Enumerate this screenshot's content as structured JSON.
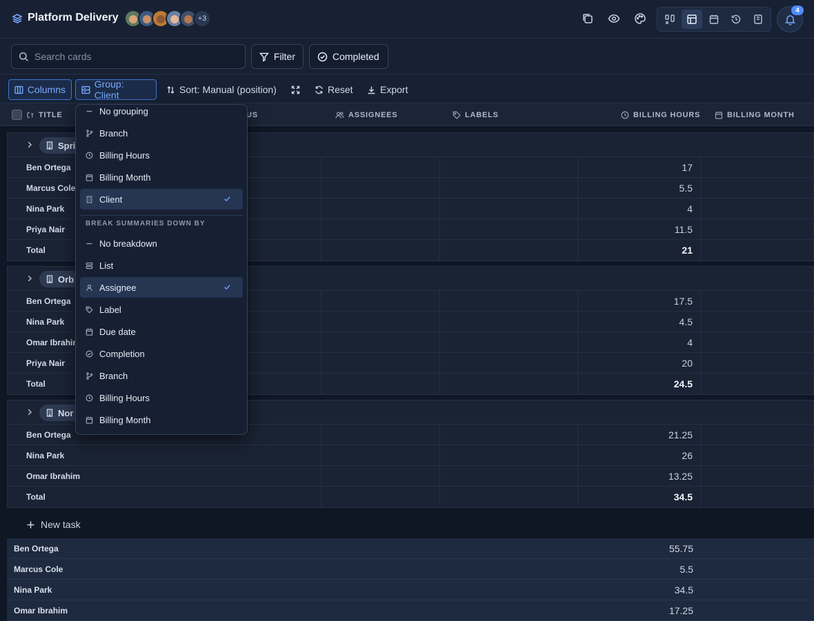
{
  "app": {
    "title": "Platform Delivery",
    "extra_members": "+3",
    "notification_count": "4"
  },
  "toolbar": {
    "search_placeholder": "Search cards",
    "filter_label": "Filter",
    "completed_label": "Completed"
  },
  "toolbar2": {
    "columns_label": "Columns",
    "group_label": "Group: Client",
    "sort_label": "Sort: Manual (position)",
    "reset_label": "Reset",
    "export_label": "Export"
  },
  "table_header": {
    "title": "TITLE",
    "status_partial": "US",
    "assignees": "ASSIGNEES",
    "labels": "LABELS",
    "billing_hours": "BILLING HOURS",
    "billing_month": "BILLING MONTH"
  },
  "groups": [
    {
      "name_partial": "Spri",
      "rows": [
        {
          "name": "Ben Ortega",
          "hours": "17"
        },
        {
          "name": "Marcus Cole",
          "hours": "5.5"
        },
        {
          "name": "Nina Park",
          "hours": "4"
        },
        {
          "name": "Priya Nair",
          "hours": "11.5"
        },
        {
          "name": "Total",
          "hours": "21"
        }
      ]
    },
    {
      "name_partial": "Orb",
      "rows": [
        {
          "name": "Ben Ortega",
          "hours": "17.5"
        },
        {
          "name": "Nina Park",
          "hours": "4.5"
        },
        {
          "name": "Omar Ibrahim",
          "hours": "4"
        },
        {
          "name": "Priya Nair",
          "hours": "20"
        },
        {
          "name": "Total",
          "hours": "24.5"
        }
      ]
    },
    {
      "name_partial": "Nor",
      "rows": [
        {
          "name": "Ben Ortega",
          "hours": "21.25"
        },
        {
          "name": "Nina Park",
          "hours": "26"
        },
        {
          "name": "Omar Ibrahim",
          "hours": "13.25"
        },
        {
          "name": "Total",
          "hours": "34.5"
        }
      ]
    }
  ],
  "new_task_label": "New task",
  "summary_rows": [
    {
      "name": "Ben Ortega",
      "hours": "55.75"
    },
    {
      "name": "Marcus Cole",
      "hours": "5.5"
    },
    {
      "name": "Nina Park",
      "hours": "34.5"
    },
    {
      "name": "Omar Ibrahim",
      "hours": "17.25"
    }
  ],
  "dropdown": {
    "group_items": [
      "No grouping",
      "Branch",
      "Billing Hours",
      "Billing Month",
      "Client"
    ],
    "group_selected": "Client",
    "breakdown_heading": "BREAK SUMMARIES DOWN BY",
    "breakdown_items": [
      "No breakdown",
      "List",
      "Assignee",
      "Label",
      "Due date",
      "Completion",
      "Branch",
      "Billing Hours",
      "Billing Month"
    ],
    "breakdown_selected": "Assignee"
  }
}
